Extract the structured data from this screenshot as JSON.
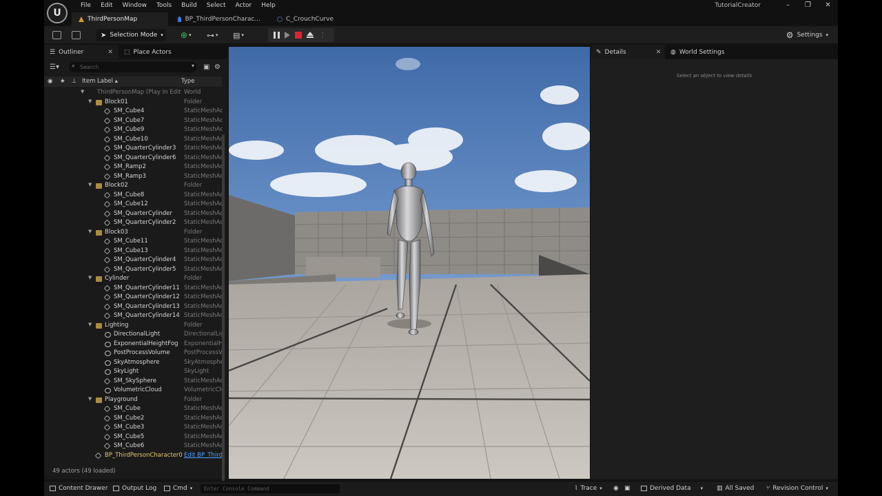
{
  "menu": {
    "logo": "U",
    "items": [
      "File",
      "Edit",
      "Window",
      "Tools",
      "Build",
      "Select",
      "Actor",
      "Help"
    ],
    "app_name": "TutorialCreator",
    "window_buttons": [
      "–",
      "❐",
      "✕"
    ]
  },
  "tabs": [
    {
      "label": "ThirdPersonMap",
      "active": true
    },
    {
      "label": "BP_ThirdPersonCharac...",
      "active": false
    },
    {
      "label": "C_CrouchCurve",
      "active": false
    }
  ],
  "toolbar": {
    "mode_label": "Selection Mode",
    "settings_label": "Settings",
    "dots": "⋮"
  },
  "outliner": {
    "tab_label": "Outliner",
    "close": "✕",
    "place_actors_label": "Place Actors",
    "search_placeholder": "Search",
    "col_label": "Item Label ▴",
    "col_type": "Type",
    "status": "49 actors (49 loaded)",
    "rows": [
      {
        "label": "ThirdPersonMap (Play In Edit",
        "type": "World",
        "depth": 0,
        "kind": "world",
        "dim": true
      },
      {
        "label": "Block01",
        "type": "Folder",
        "depth": 1,
        "kind": "folder"
      },
      {
        "label": "SM_Cube4",
        "type": "StaticMeshActor",
        "depth": 2,
        "kind": "mesh"
      },
      {
        "label": "SM_Cube7",
        "type": "StaticMeshActor",
        "depth": 2,
        "kind": "mesh"
      },
      {
        "label": "SM_Cube9",
        "type": "StaticMeshActor",
        "depth": 2,
        "kind": "mesh"
      },
      {
        "label": "SM_Cube10",
        "type": "StaticMeshActor",
        "depth": 2,
        "kind": "mesh"
      },
      {
        "label": "SM_QuarterCylinder3",
        "type": "StaticMeshActor",
        "depth": 2,
        "kind": "mesh"
      },
      {
        "label": "SM_QuarterCylinder6",
        "type": "StaticMeshActor",
        "depth": 2,
        "kind": "mesh"
      },
      {
        "label": "SM_Ramp2",
        "type": "StaticMeshActor",
        "depth": 2,
        "kind": "mesh"
      },
      {
        "label": "SM_Ramp3",
        "type": "StaticMeshActor",
        "depth": 2,
        "kind": "mesh"
      },
      {
        "label": "Block02",
        "type": "Folder",
        "depth": 1,
        "kind": "folder"
      },
      {
        "label": "SM_Cube8",
        "type": "StaticMeshActor",
        "depth": 2,
        "kind": "mesh"
      },
      {
        "label": "SM_Cube12",
        "type": "StaticMeshActor",
        "depth": 2,
        "kind": "mesh"
      },
      {
        "label": "SM_QuarterCylinder",
        "type": "StaticMeshActor",
        "depth": 2,
        "kind": "mesh"
      },
      {
        "label": "SM_QuarterCylinder2",
        "type": "StaticMeshActor",
        "depth": 2,
        "kind": "mesh"
      },
      {
        "label": "Block03",
        "type": "Folder",
        "depth": 1,
        "kind": "folder"
      },
      {
        "label": "SM_Cube11",
        "type": "StaticMeshActor",
        "depth": 2,
        "kind": "mesh"
      },
      {
        "label": "SM_Cube13",
        "type": "StaticMeshActor",
        "depth": 2,
        "kind": "mesh"
      },
      {
        "label": "SM_QuarterCylinder4",
        "type": "StaticMeshActor",
        "depth": 2,
        "kind": "mesh"
      },
      {
        "label": "SM_QuarterCylinder5",
        "type": "StaticMeshActor",
        "depth": 2,
        "kind": "mesh"
      },
      {
        "label": "Cylinder",
        "type": "Folder",
        "depth": 1,
        "kind": "folder"
      },
      {
        "label": "SM_QuarterCylinder11",
        "type": "StaticMeshActor",
        "depth": 2,
        "kind": "mesh"
      },
      {
        "label": "SM_QuarterCylinder12",
        "type": "StaticMeshActor",
        "depth": 2,
        "kind": "mesh"
      },
      {
        "label": "SM_QuarterCylinder13",
        "type": "StaticMeshActor",
        "depth": 2,
        "kind": "mesh"
      },
      {
        "label": "SM_QuarterCylinder14",
        "type": "StaticMeshActor",
        "depth": 2,
        "kind": "mesh"
      },
      {
        "label": "Lighting",
        "type": "Folder",
        "depth": 1,
        "kind": "folder"
      },
      {
        "label": "DirectionalLight",
        "type": "DirectionalLight",
        "depth": 2,
        "kind": "light"
      },
      {
        "label": "ExponentialHeightFog",
        "type": "ExponentialHeightFog",
        "depth": 2,
        "kind": "light"
      },
      {
        "label": "PostProcessVolume",
        "type": "PostProcessVolume",
        "depth": 2,
        "kind": "light"
      },
      {
        "label": "SkyAtmosphere",
        "type": "SkyAtmosphere",
        "depth": 2,
        "kind": "light"
      },
      {
        "label": "SkyLight",
        "type": "SkyLight",
        "depth": 2,
        "kind": "light"
      },
      {
        "label": "SM_SkySphere",
        "type": "StaticMeshActor",
        "depth": 2,
        "kind": "mesh"
      },
      {
        "label": "VolumetricCloud",
        "type": "VolumetricCloud",
        "depth": 2,
        "kind": "light"
      },
      {
        "label": "Playground",
        "type": "Folder",
        "depth": 1,
        "kind": "folder"
      },
      {
        "label": "SM_Cube",
        "type": "StaticMeshActor",
        "depth": 2,
        "kind": "mesh"
      },
      {
        "label": "SM_Cube2",
        "type": "StaticMeshActor",
        "depth": 2,
        "kind": "mesh"
      },
      {
        "label": "SM_Cube3",
        "type": "StaticMeshActor",
        "depth": 2,
        "kind": "mesh"
      },
      {
        "label": "SM_Cube5",
        "type": "StaticMeshActor",
        "depth": 2,
        "kind": "mesh"
      },
      {
        "label": "SM_Cube6",
        "type": "StaticMeshActor",
        "depth": 2,
        "kind": "mesh"
      },
      {
        "label": "BP_ThirdPersonCharacter0",
        "type": "Edit BP_ThirdPersonCharacter",
        "depth": 1,
        "kind": "pawn",
        "highlight": true
      }
    ]
  },
  "details": {
    "tab_label": "Details",
    "close": "✕",
    "world_settings_label": "World Settings",
    "hint": "Select an object to view details"
  },
  "bottom": {
    "content_drawer": "Content Drawer",
    "output_log": "Output Log",
    "cmd": "Cmd",
    "console_placeholder": "Enter Console Command",
    "trace": "Trace",
    "derived_data": "Derived Data",
    "all_saved": "All Saved",
    "revision_control": "Revision Control"
  },
  "colors": {
    "accent_play_stop": "#e0242c",
    "highlight_actor": "#e9c66a",
    "link": "#4ea1ff",
    "folder": "#b08a3c"
  }
}
